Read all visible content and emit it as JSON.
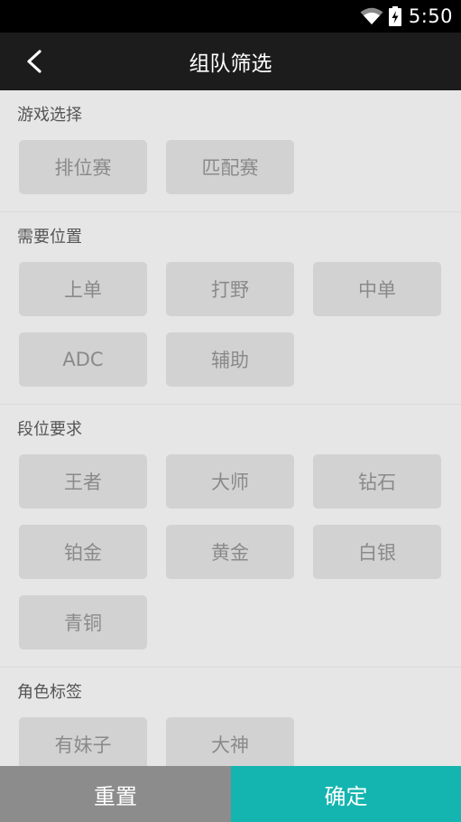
{
  "status_bar": {
    "time": "5:50",
    "wifi_icon": "wifi-icon",
    "battery_icon": "battery-charging-icon"
  },
  "header": {
    "title": "组队筛选",
    "back_icon": "back-arrow-icon"
  },
  "sections": [
    {
      "title": "游戏选择",
      "options": [
        "排位赛",
        "匹配赛"
      ]
    },
    {
      "title": "需要位置",
      "options": [
        "上单",
        "打野",
        "中单",
        "ADC",
        "辅助"
      ]
    },
    {
      "title": "段位要求",
      "options": [
        "王者",
        "大师",
        "钻石",
        "铂金",
        "黄金",
        "白银",
        "青铜"
      ]
    },
    {
      "title": "角色标签",
      "options": [
        "有妹子",
        "大神"
      ]
    }
  ],
  "footer": {
    "reset_label": "重置",
    "confirm_label": "确定"
  },
  "colors": {
    "confirm": "#14b5b0",
    "reset": "#8c8c8c",
    "chip_bg": "#d2d2d2",
    "page_bg": "#e6e6e6"
  }
}
